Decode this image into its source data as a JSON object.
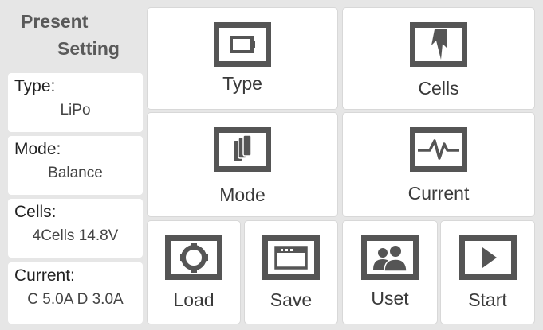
{
  "present": {
    "line1": "Present",
    "line2": "Setting"
  },
  "info": [
    {
      "label": "Type:",
      "value": "LiPo"
    },
    {
      "label": "Mode:",
      "value": "Balance"
    },
    {
      "label": "Cells:",
      "value": "4Cells 14.8V"
    },
    {
      "label": "Current:",
      "value": "C 5.0A D 3.0A"
    }
  ],
  "tiles": {
    "type": {
      "label": "Type",
      "icon": "battery-icon"
    },
    "cells": {
      "label": "Cells",
      "icon": "lightning-icon"
    },
    "mode": {
      "label": "Mode",
      "icon": "stack-icon"
    },
    "current": {
      "label": "Current",
      "icon": "waveform-icon"
    },
    "load": {
      "label": "Load",
      "icon": "load-icon"
    },
    "save": {
      "label": "Save",
      "icon": "save-window-icon"
    },
    "uset": {
      "label": "Uset",
      "icon": "users-icon"
    },
    "start": {
      "label": "Start",
      "icon": "play-icon"
    }
  }
}
